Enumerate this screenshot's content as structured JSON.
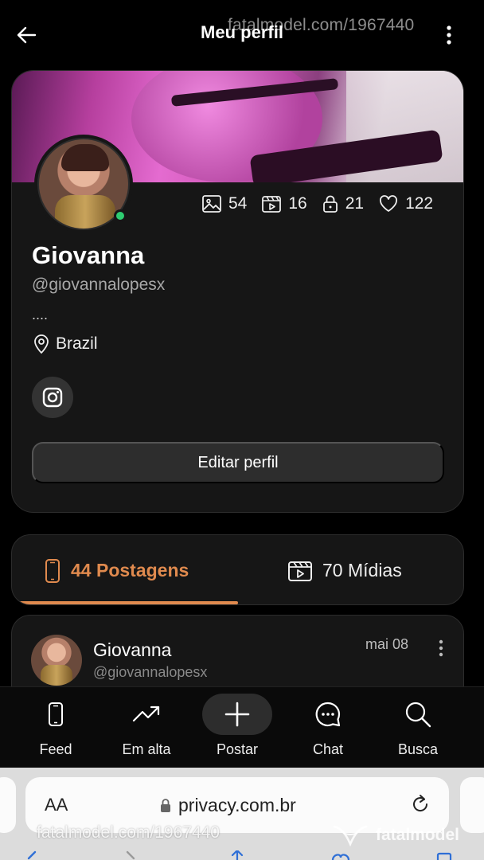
{
  "header": {
    "title": "Meu perfil",
    "watermark": "fatalmodel.com/1967440"
  },
  "profile": {
    "name": "Giovanna",
    "handle": "@giovannalopesx",
    "bio": "....",
    "location": "Brazil",
    "online": true,
    "stats": {
      "photos": "54",
      "videos": "16",
      "locked": "21",
      "likes": "122"
    },
    "edit_label": "Editar perfil"
  },
  "tabs": {
    "posts_label": "44 Postagens",
    "media_label": "70 Mídias",
    "active": "posts",
    "accent": "#e08a4e"
  },
  "post": {
    "author": "Giovanna",
    "handle": "@giovannalopesx",
    "date": "mai 08"
  },
  "nav": {
    "items": [
      {
        "label": "Feed",
        "icon": "phone-icon"
      },
      {
        "label": "Em alta",
        "icon": "trending-icon"
      },
      {
        "label": "Postar",
        "icon": "plus-icon"
      },
      {
        "label": "Chat",
        "icon": "chat-icon"
      },
      {
        "label": "Busca",
        "icon": "search-icon"
      }
    ]
  },
  "browser": {
    "text_size": "AA",
    "url": "privacy.com.br"
  },
  "watermark_bottom": {
    "url": "fatalmodel.com/1967440",
    "brand": "fatalmodel"
  },
  "colors": {
    "background": "#000000",
    "card": "#161616",
    "online": "#2ecc71"
  }
}
